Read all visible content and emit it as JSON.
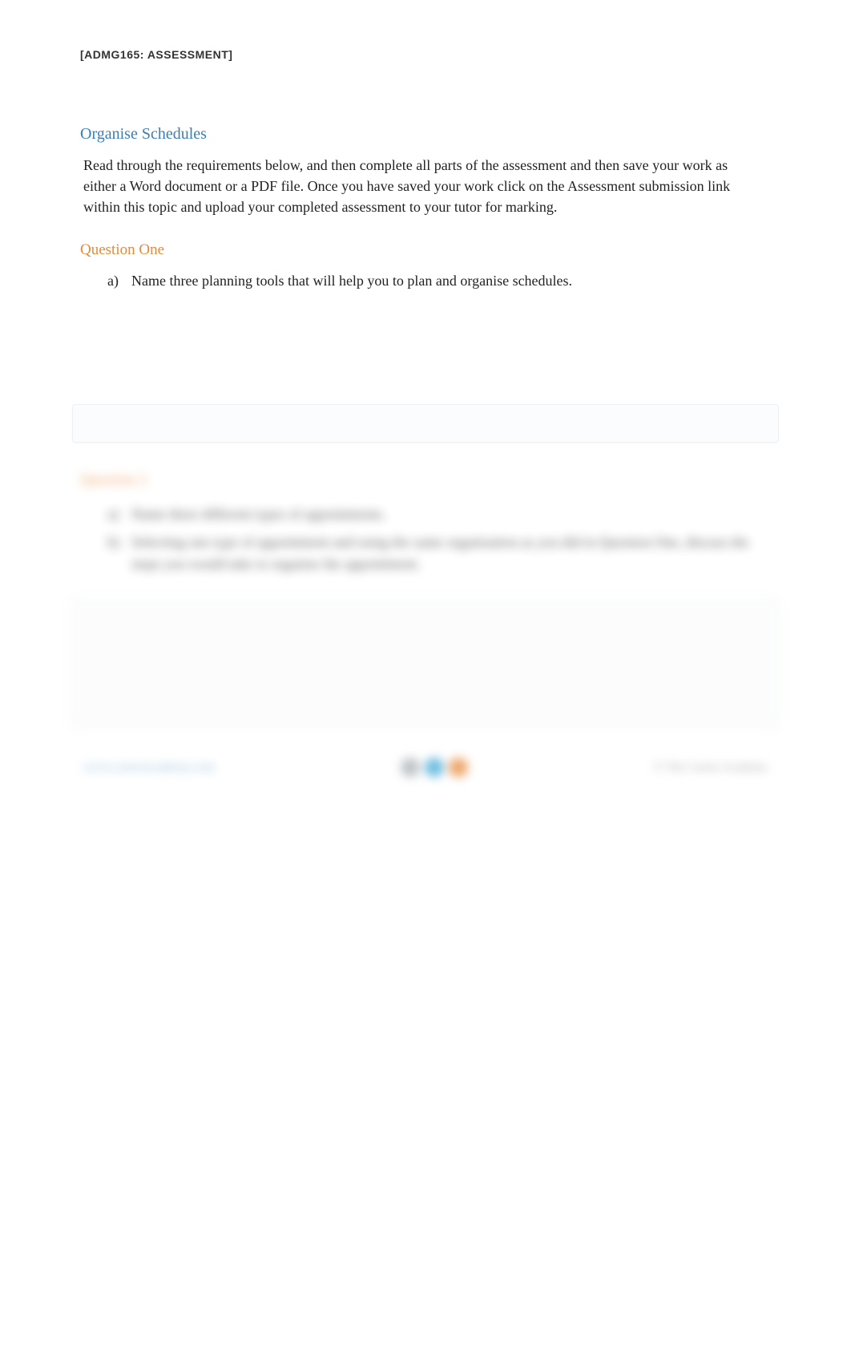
{
  "header": {
    "title": "[ADMG165: ASSESSMENT]"
  },
  "section": {
    "title": "Organise Schedules",
    "instructions": "Read through the requirements below, and then complete all parts of the assessment and then save your work as either a Word document or a PDF file. Once you have saved your work click on the Assessment submission link within this topic and upload your completed assessment to your tutor for marking."
  },
  "question_one": {
    "heading": "Question One",
    "items": [
      {
        "marker": "a)",
        "text": "Name three planning tools that will help you to plan and organise schedules."
      }
    ]
  },
  "question_two": {
    "heading": "Question 2",
    "items": [
      {
        "marker": "a)",
        "text": "Name three different types of appointments."
      },
      {
        "marker": "b)",
        "text": "Selecting one type of appointment and using the same organisation as you did in Question One, discuss the steps you would take to organise the appointment."
      }
    ]
  },
  "footer": {
    "link": "www.careeracademy.com",
    "copyright": "© The Career Academy"
  }
}
